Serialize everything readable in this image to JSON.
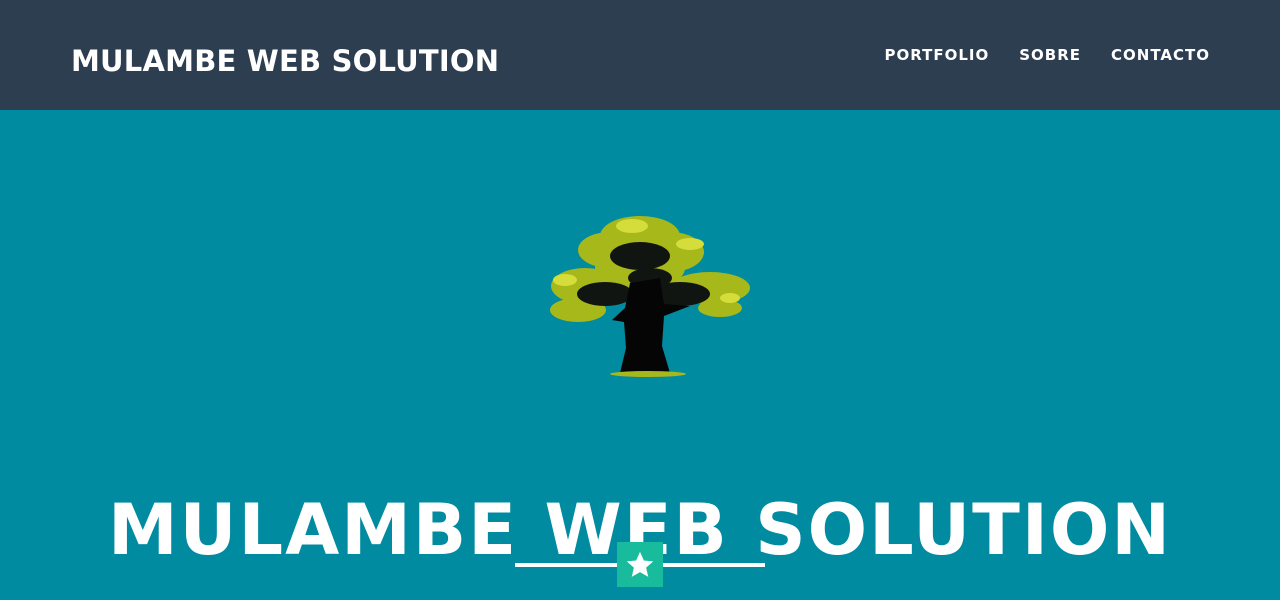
{
  "navbar": {
    "brand": "MULAMBE WEB SOLUTION",
    "background": "#2e3e51",
    "links": [
      {
        "label": "PORTFOLIO"
      },
      {
        "label": "SOBRE"
      },
      {
        "label": "CONTACTO"
      }
    ]
  },
  "hero": {
    "background": "#008ba0",
    "logo_icon": "baobab-tree-icon",
    "title": "MULAMBE WEB SOLUTION",
    "divider_icon": "star-icon",
    "divider_accent": "#18bc9c"
  }
}
